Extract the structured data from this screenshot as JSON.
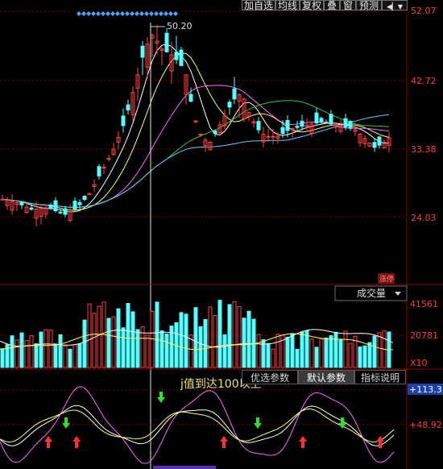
{
  "toolbar": {
    "add_watchlist": "加自选",
    "ma_line": "均线",
    "restore_rights": "复权",
    "overlay": "叠",
    "window": "窗",
    "forecast": "预测"
  },
  "price_panel": {
    "axis_labels": [
      "52.07",
      "42.72",
      "33.38",
      "24.03"
    ],
    "peak_label": "50.20",
    "limit_up_tag": "涨停"
  },
  "volume_panel": {
    "selector_label": "成交量",
    "axis_labels": [
      "41561",
      "20781"
    ],
    "unit_label": "X10"
  },
  "indicator_panel": {
    "tabs": [
      "优选参数",
      "默认参数",
      "指标说明"
    ],
    "active_tab": "默认参数",
    "annotation": "j值到达100以上",
    "axis_labels": [
      "+113.3",
      "+48.92"
    ]
  },
  "colors": {
    "up_candle": "#ff4040",
    "down_candle": "#54ffff",
    "ma5": "#ffffff",
    "ma10": "#ffff66",
    "ma20": "#ff66ff",
    "ma30": "#33cc33",
    "ma60": "#66ccff",
    "axis_text": "#ff3b3b",
    "diamond_markers": "#4da6ff",
    "buy_arrow": "#ff3030",
    "sell_arrow": "#30e030"
  }
}
